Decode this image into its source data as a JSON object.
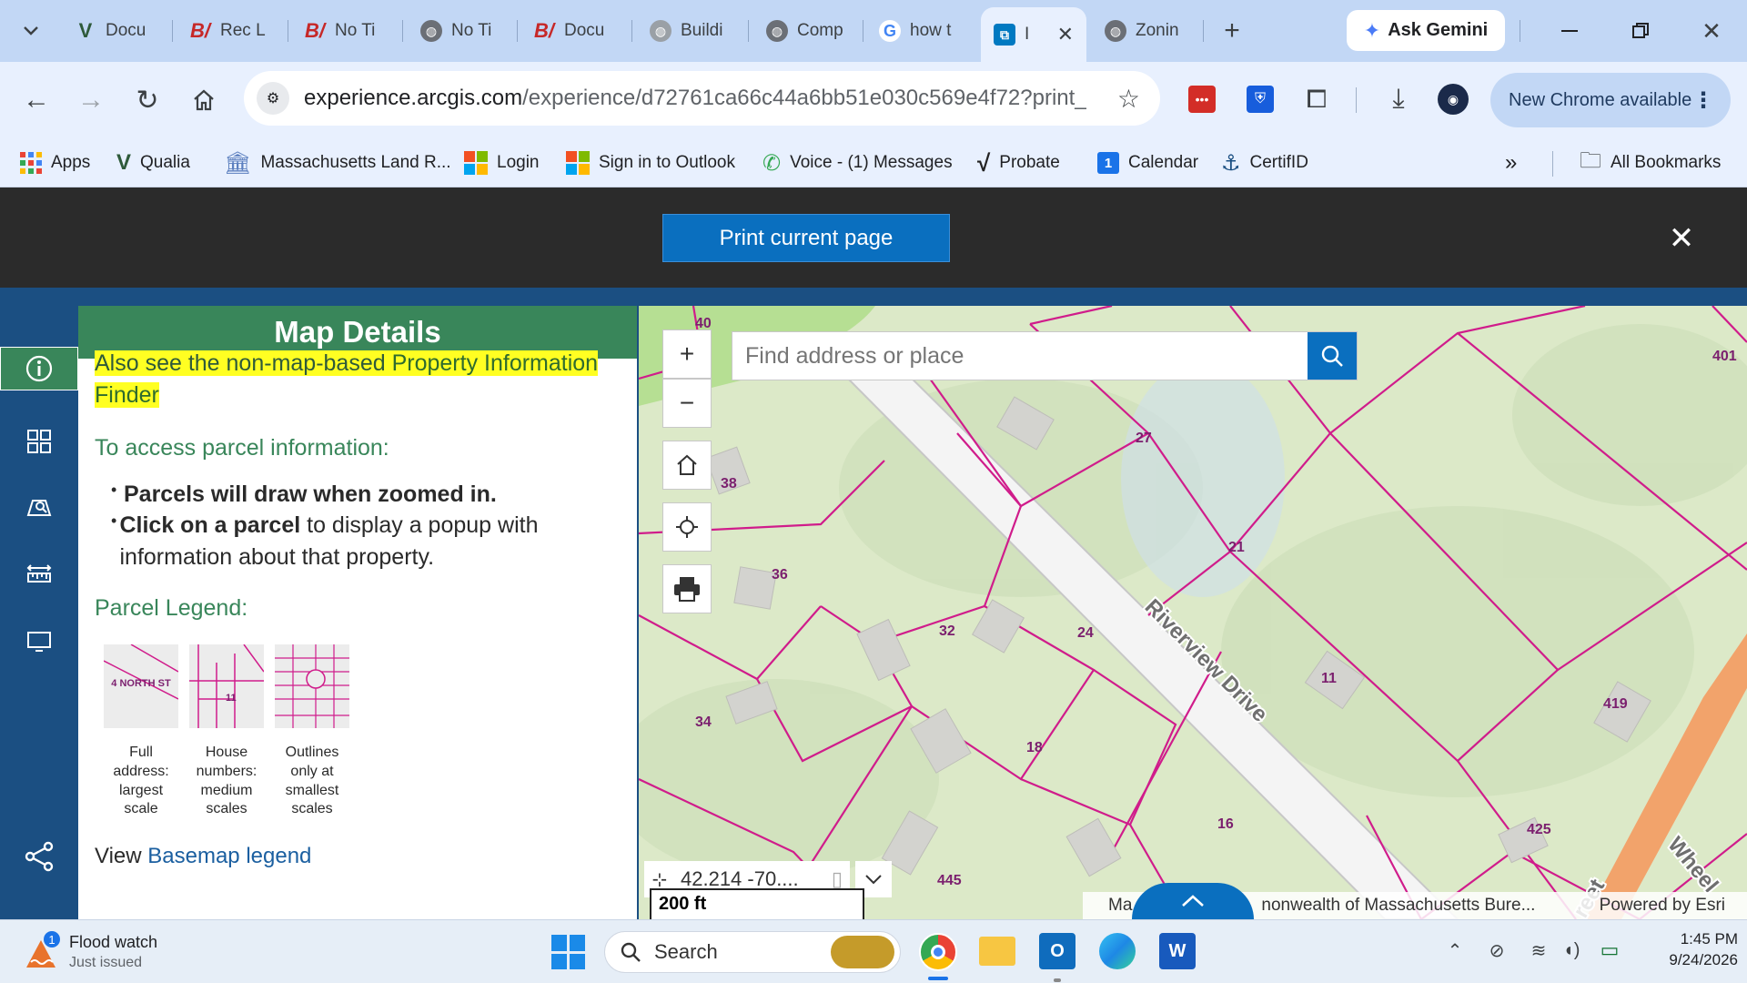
{
  "browser": {
    "tabs": [
      {
        "label": "Docu",
        "icon": "v-icon"
      },
      {
        "label": "Rec L",
        "icon": "b-icon"
      },
      {
        "label": "No Ti",
        "icon": "b-icon"
      },
      {
        "label": "No Ti",
        "icon": "globe-icon"
      },
      {
        "label": "Docu",
        "icon": "b-icon"
      },
      {
        "label": "Buildi",
        "icon": "globe-icon"
      },
      {
        "label": "Comp",
        "icon": "globe-icon"
      },
      {
        "label": "how t",
        "icon": "google-icon"
      },
      {
        "label": "I",
        "icon": "arcgis-icon",
        "active": true
      },
      {
        "label": "Zonin",
        "icon": "globe-icon"
      }
    ],
    "gemini_label": "Ask Gemini",
    "url_domain": "experience.arcgis.com",
    "url_path": "/experience/d72761ca66c44a6bb51e030c569e4f72?print_...",
    "update_label": "New Chrome available",
    "bookmarks": [
      {
        "label": "Apps",
        "color": "#ea4335"
      },
      {
        "label": "Qualia",
        "color": "#2e5a3a"
      },
      {
        "label": "Massachusetts Land R...",
        "color": "#5b7fbf"
      },
      {
        "label": "Login",
        "color": "#f25022"
      },
      {
        "label": "Sign in to Outlook",
        "color": "#7fba00"
      },
      {
        "label": "Voice - (1) Messages",
        "color": "#34a853"
      },
      {
        "label": "Probate",
        "color": "#222222"
      },
      {
        "label": "Calendar",
        "color": "#1a73e8"
      },
      {
        "label": "CertifID",
        "color": "#1b4f82"
      }
    ],
    "all_bookmarks_label": "All Bookmarks"
  },
  "print_bar": {
    "button_label": "Print current page"
  },
  "panel": {
    "title": "Map Details",
    "highlight_text": "Also see the non-map-based ",
    "highlight_link": "Property Information Finder",
    "access_heading": "To access parcel information:",
    "bullet1": "Parcels will draw when zoomed in.",
    "bullet2_bold": "Click on a parcel",
    "bullet2_rest": " to display a popup with information about that property.",
    "legend_heading": "Parcel Legend:",
    "legend": [
      {
        "caption": "Full address: largest scale",
        "sample": "4 NORTH ST"
      },
      {
        "caption": "House numbers: medium scales",
        "sample": "11"
      },
      {
        "caption": "Outlines only at smallest scales",
        "sample": ""
      }
    ],
    "view_prefix": "View ",
    "basemap_link": "Basemap legend"
  },
  "map": {
    "search_placeholder": "Find address or place",
    "coordinates": "42.214 -70....",
    "scale_label": "200 ft",
    "attribution": "Ma",
    "attribution2": "nonwealth of Massachusetts Bure...",
    "powered_by": "Powered by Esri",
    "road_label": "Riverview Drive",
    "road2": "Wheel",
    "road3": "reet",
    "parcels": [
      "40",
      "401",
      "27",
      "38",
      "21",
      "36",
      "32",
      "24",
      "11",
      "419",
      "34",
      "18",
      "16",
      "425",
      "445"
    ]
  },
  "taskbar": {
    "notification_title": "Flood watch",
    "notification_sub": "Just issued",
    "notification_count": "1",
    "search_label": "Search",
    "time": "1:45 PM",
    "date": "9/24/2026"
  }
}
